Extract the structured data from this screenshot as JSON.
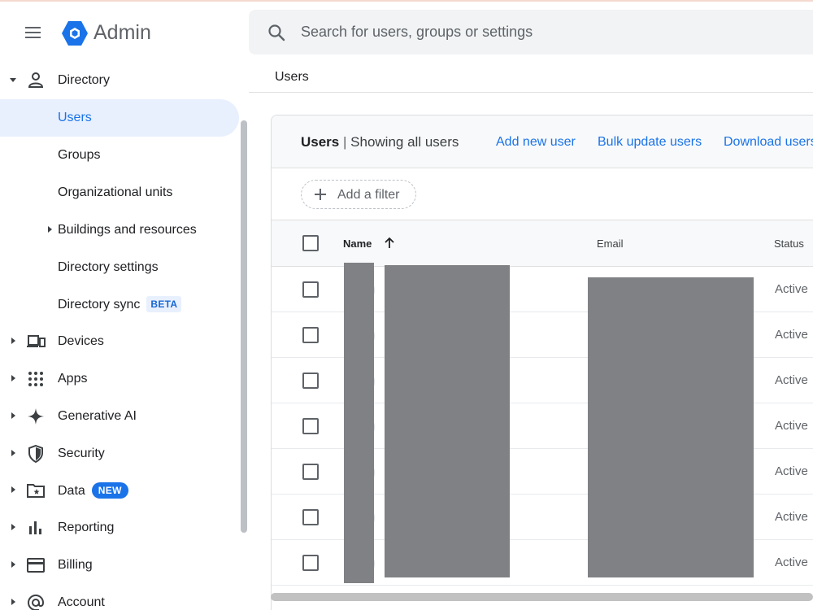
{
  "header": {
    "app_title": "Admin",
    "menu_icon": "hamburger-menu-icon",
    "logo_icon": "admin-hexagon-logo",
    "search": {
      "placeholder": "Search for users, groups or settings",
      "value": ""
    },
    "brand_color": "#1a73e8"
  },
  "sidebar": {
    "items": [
      {
        "label": "Directory",
        "icon": "person-icon",
        "expanded": true
      },
      {
        "label": "Users",
        "active": true
      },
      {
        "label": "Groups"
      },
      {
        "label": "Organizational units"
      },
      {
        "label": "Buildings and resources",
        "collapsed": true
      },
      {
        "label": "Directory settings"
      },
      {
        "label": "Directory sync",
        "badge": "BETA"
      },
      {
        "label": "Devices",
        "icon": "devices-icon"
      },
      {
        "label": "Apps",
        "icon": "apps-grid-icon"
      },
      {
        "label": "Generative AI",
        "icon": "sparkle-icon"
      },
      {
        "label": "Security",
        "icon": "shield-icon"
      },
      {
        "label": "Data",
        "icon": "folder-star-icon",
        "badge": "NEW"
      },
      {
        "label": "Reporting",
        "icon": "bar-chart-icon"
      },
      {
        "label": "Billing",
        "icon": "credit-card-icon"
      },
      {
        "label": "Account",
        "icon": "at-sign-icon"
      }
    ]
  },
  "main": {
    "breadcrumb": "Users",
    "card": {
      "title": "Users",
      "separator": "|",
      "subtitle": "Showing all users",
      "actions": [
        "Add new user",
        "Bulk update users",
        "Download users"
      ]
    },
    "filter": {
      "label": "Add a filter"
    },
    "table": {
      "columns": [
        "Name",
        "Email",
        "Status"
      ],
      "sort": {
        "column": "Name",
        "direction": "ascending"
      },
      "rows": [
        {
          "status": "Active"
        },
        {
          "status": "Active"
        },
        {
          "status": "Active"
        },
        {
          "status": "Active"
        },
        {
          "status": "Active"
        },
        {
          "status": "Active"
        },
        {
          "status": "Active"
        }
      ]
    }
  }
}
